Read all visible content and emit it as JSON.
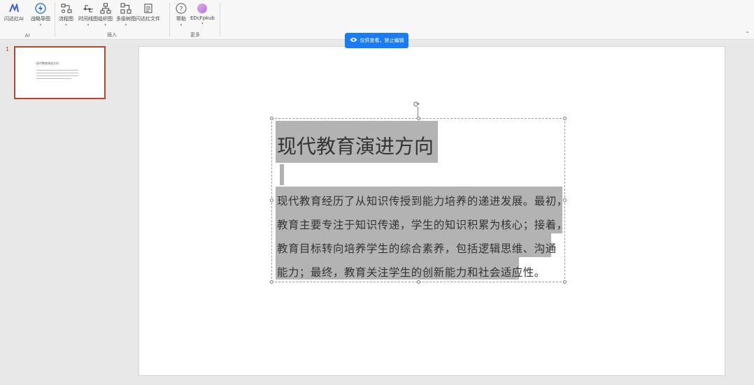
{
  "ribbon": {
    "groups": [
      {
        "label": "AI",
        "buttons": [
          {
            "name": "ai-write-button",
            "icon": "ai-logo-icon",
            "label": "闪达红AI"
          },
          {
            "name": "mindmap-button",
            "icon": "lightning-icon",
            "label": "战略导图"
          }
        ]
      },
      {
        "label": "插入",
        "buttons": [
          {
            "name": "flowchart-button",
            "icon": "flowchart-icon",
            "label": "流程图"
          },
          {
            "name": "timeline-button",
            "icon": "timeline-icon",
            "label": "时间线图"
          },
          {
            "name": "org-chart-button",
            "icon": "org-chart-icon",
            "label": "组织图"
          },
          {
            "name": "matrix-chart-button",
            "icon": "matrix-icon",
            "label": "多级树图"
          },
          {
            "name": "doc-insert-button",
            "icon": "document-icon",
            "label": "闪达红文件"
          }
        ]
      },
      {
        "label": "更多",
        "buttons": [
          {
            "name": "help-button",
            "icon": "help-icon",
            "label": "帮助"
          },
          {
            "name": "profile-button",
            "icon": "avatar-icon",
            "label": "EDcFpkub"
          }
        ]
      }
    ],
    "collapse_glyph": "⌃"
  },
  "banner": {
    "text": "仅供查看，禁止编辑"
  },
  "thumbnails": [
    {
      "number": "1",
      "title": "现代教育演进方向"
    }
  ],
  "slide": {
    "title": "现代教育演进方向",
    "body": [
      "现代教育经历了从知识传授到能力培养的递进发展。最初，",
      "教育主要专注于知识传递，学生的知识积累为核心；接着，",
      "教育目标转向培养学生的综合素养，包括逻辑思维、沟通",
      "能力；最终，教育关注学生的创新能力和社会适应性。"
    ]
  },
  "colors": {
    "accent": "#1a7cf5",
    "selection": "#b3b3b3",
    "thumb_border": "#c0452b"
  }
}
